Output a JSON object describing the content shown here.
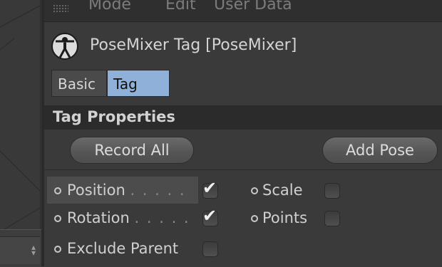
{
  "menubar": {
    "items": [
      "Mode",
      "Edit",
      "User Data"
    ]
  },
  "header": {
    "title": "PoseMixer Tag [PoseMixer]",
    "icon": "posemixer-figure-icon"
  },
  "tabs": [
    {
      "label": "Basic",
      "active": false
    },
    {
      "label": "Tag",
      "active": true
    }
  ],
  "section": {
    "title": "Tag Properties"
  },
  "buttons": {
    "record_all": "Record All",
    "add_pose": "Add Pose"
  },
  "properties": {
    "position": {
      "label": "Position",
      "dots": ". . . . .",
      "checked": true
    },
    "rotation": {
      "label": "Rotation",
      "dots": ". . . . .",
      "checked": true
    },
    "exclude_parent": {
      "label": "Exclude Parent",
      "checked": false
    },
    "scale": {
      "label": "Scale",
      "checked": false
    },
    "points": {
      "label": "Points",
      "checked": false
    }
  },
  "colors": {
    "active_tab": "#8fb0d8",
    "panel_bg": "#3a3a3a",
    "section_bg": "#2b2b2b"
  }
}
